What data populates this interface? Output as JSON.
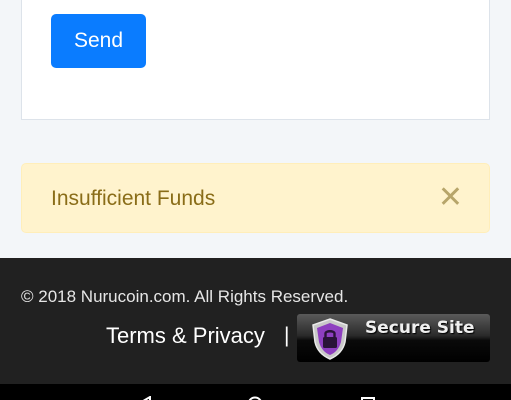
{
  "form": {
    "send_label": "Send"
  },
  "alert": {
    "message": "Insufficient Funds",
    "close_symbol": "✕"
  },
  "footer": {
    "copyright": "© 2018 Nurucoin.com. All Rights Reserved.",
    "terms_label": "Terms & Privacy",
    "separator": "|",
    "seal_label": "Secure Site"
  },
  "navbar": {
    "icons": [
      "back-icon",
      "home-icon",
      "recents-icon"
    ]
  },
  "colors": {
    "primary": "#0a7cff",
    "alert_bg": "#fff3cd",
    "alert_text": "#8a6d18",
    "footer_bg": "#212121",
    "seal_purple": "#8e3fc0"
  }
}
